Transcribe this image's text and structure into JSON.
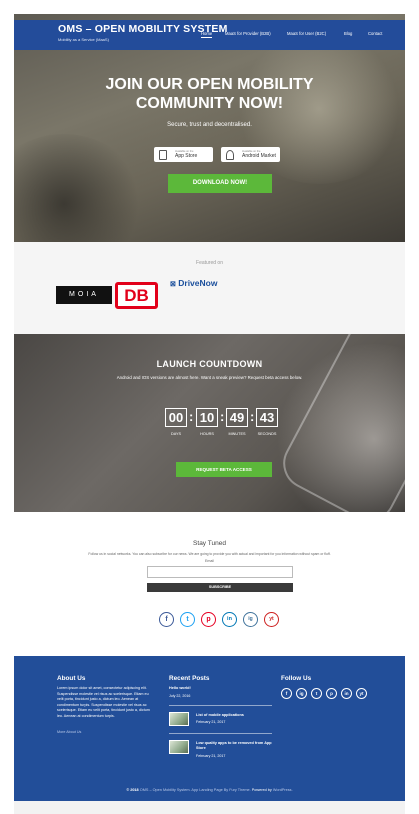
{
  "header": {
    "brand": "OMS – OPEN MOBILITY SYSTEM",
    "brand_tagline": "Mobility as a Service (MaaS)",
    "nav": [
      "Home",
      "MaaS for Provider (B2B)",
      "MaaS for User (B2C)",
      "Blog",
      "Contact"
    ]
  },
  "hero": {
    "title_line1": "JOIN OUR OPEN MOBILITY",
    "title_line2": "COMMUNITY NOW!",
    "subtitle": "Secure, trust and decentralised.",
    "app_store_small": "Available on the",
    "app_store_big": "App Store",
    "android_small": "Available on the",
    "android_big": "Android Market",
    "download_label": "DOWNLOAD NOW!"
  },
  "featured": {
    "label": "Featured on",
    "logos": [
      "MOIA",
      "DB",
      "DriveNow"
    ]
  },
  "countdown": {
    "title": "LAUNCH COUNTDOWN",
    "subtitle": "Android and IOS versions are almost here. Want a sneak preview? Request beta access below.",
    "days": "00",
    "hours": "10",
    "minutes": "49",
    "seconds": "43",
    "unit_days": "DAYS",
    "unit_hours": "HOURS",
    "unit_minutes": "MINUTES",
    "unit_seconds": "SECONDS",
    "beta_label": "REQUEST BETA ACCESS"
  },
  "stay_tuned": {
    "title": "Stay Tuned",
    "description": "Follow us in social networks. You can also subscribe for our news. We are going to provide you with actual and important for you information without spam or fluff.",
    "email_label": "Email",
    "email_value": "",
    "subscribe_label": "SUBSCRIBE",
    "social": [
      "f",
      "t",
      "p",
      "in",
      "ig",
      "yt"
    ]
  },
  "footer": {
    "about_title": "About Us",
    "about_text": "Lorem ipsum dolor sit amet, consectetur adipiscing elit. Suspendisse molestie vel risus ac scelerisque. Etiam eu velit porta, tincidunt justo a, dictum leo. Aenean at condimentum turpis. Suspendisse molestie vel risus ac scelerisque. Etiam eu velit porta, tincidunt justo a, dictum leo. Aenean at condimentum turpis.",
    "about_more": "More About Us",
    "recent_title": "Recent Posts",
    "posts": [
      {
        "title": "Hello world!",
        "date": "July 22, 2016"
      },
      {
        "title": "List of mobile applications",
        "date": "February 21, 2017"
      },
      {
        "title": "Low quality apps to be removed from App Store",
        "date": "February 21, 2017"
      }
    ],
    "follow_title": "Follow Us",
    "copyright_prefix": "© 2018",
    "copyright_mid": "OMS – Open Mobility System. App Landing Page By Fury Theme.",
    "copyright_powered": "Powered by",
    "copyright_wp": "WordPress."
  },
  "colors": {
    "nav_blue": "#234c9a",
    "cta_green": "#5cb83a",
    "footer_blue": "#224e99",
    "db_red": "#e2001a"
  }
}
